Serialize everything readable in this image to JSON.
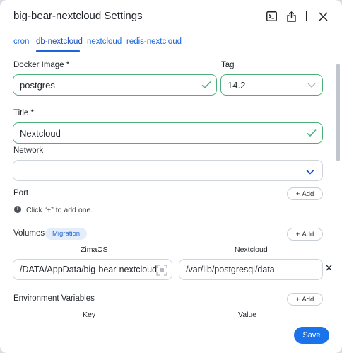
{
  "header": {
    "title": "big-bear-nextcloud Settings"
  },
  "tabs": [
    {
      "label": "cron"
    },
    {
      "label": "db-nextcloud",
      "active": true
    },
    {
      "label": "nextcloud"
    },
    {
      "label": "redis-nextcloud"
    }
  ],
  "form": {
    "docker_image": {
      "label": "Docker Image *",
      "value": "postgres"
    },
    "tag": {
      "label": "Tag",
      "value": "14.2"
    },
    "title": {
      "label": "Title *",
      "value": "Nextcloud"
    },
    "network": {
      "label": "Network",
      "value": ""
    },
    "port": {
      "label": "Port",
      "add_label": "Add",
      "hint": "Click “+” to add one."
    },
    "volumes": {
      "label": "Volumes",
      "badge": "Migration",
      "add_label": "Add",
      "columns": [
        "ZimaOS",
        "Nextcloud"
      ],
      "rows": [
        {
          "host": "/DATA/AppData/big-bear-nextcloud",
          "container": "/var/lib/postgresql/data"
        }
      ]
    },
    "env": {
      "label": "Environment Variables",
      "add_label": "Add",
      "columns": [
        "Key",
        "Value"
      ]
    }
  },
  "footer": {
    "save_label": "Save"
  },
  "colors": {
    "accent": "#1a73e8",
    "valid": "#4caf7b"
  }
}
